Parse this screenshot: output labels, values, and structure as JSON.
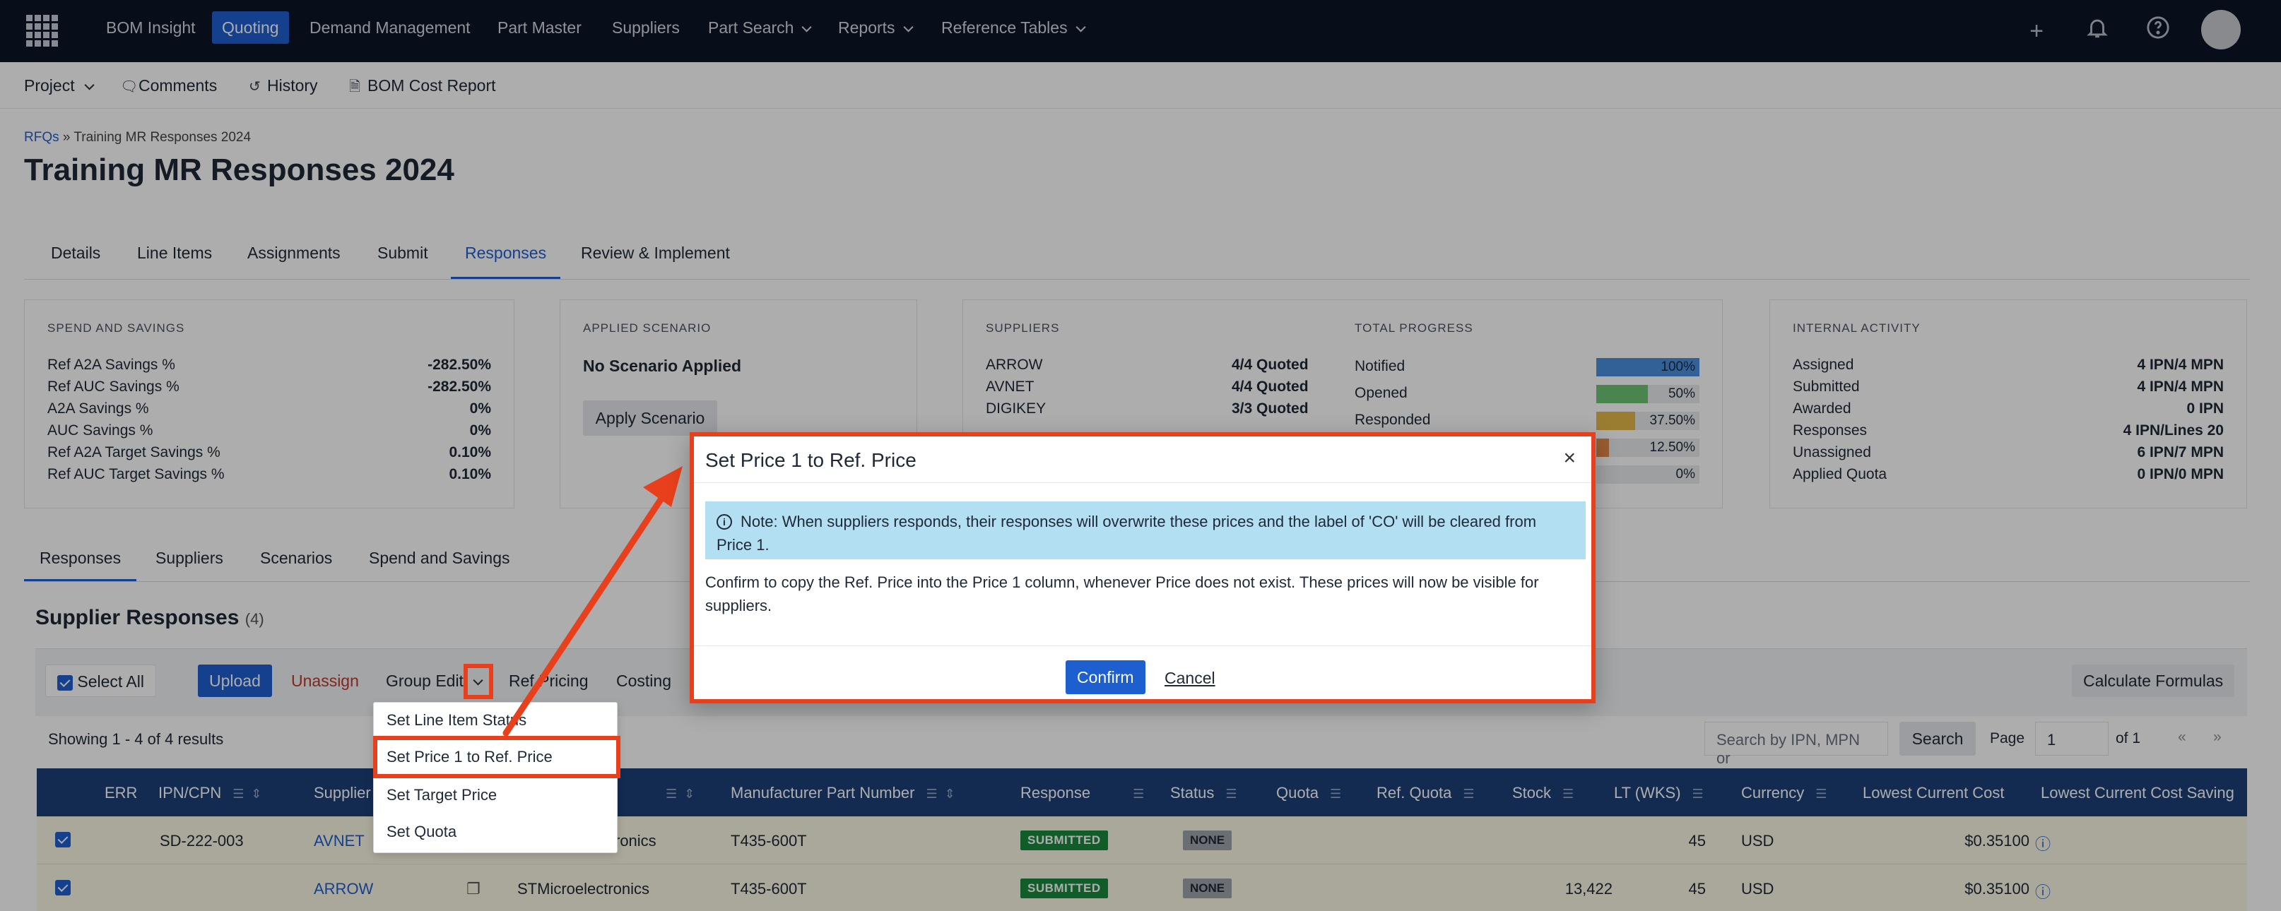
{
  "nav": {
    "items": [
      "BOM Insight",
      "Quoting",
      "Demand Management",
      "Part Master",
      "Suppliers",
      "Part Search",
      "Reports",
      "Reference Tables"
    ],
    "active": "Quoting"
  },
  "subbar": {
    "project": "Project",
    "comments": "Comments",
    "history": "History",
    "bom_cost_report": "BOM Cost Report"
  },
  "breadcrumb": {
    "root": "RFQs",
    "sep": "»",
    "current": "Training MR Responses 2024"
  },
  "page_title": "Training MR Responses 2024",
  "tabs": [
    "Details",
    "Line Items",
    "Assignments",
    "Submit",
    "Responses",
    "Review & Implement"
  ],
  "spend": {
    "title": "SPEND AND SAVINGS",
    "rows": [
      {
        "label": "Ref A2A Savings %",
        "value": "-282.50%"
      },
      {
        "label": "Ref AUC Savings %",
        "value": "-282.50%"
      },
      {
        "label": "A2A Savings %",
        "value": "0%"
      },
      {
        "label": "AUC Savings %",
        "value": "0%"
      },
      {
        "label": "Ref A2A Target Savings %",
        "value": "0.10%"
      },
      {
        "label": "Ref AUC Target Savings %",
        "value": "0.10%"
      }
    ]
  },
  "scenario": {
    "title": "APPLIED SCENARIO",
    "status": "No Scenario Applied",
    "apply_label": "Apply Scenario"
  },
  "suppliers_card": {
    "title": "SUPPLIERS",
    "rows": [
      {
        "name": "ARROW",
        "value": "4/4 Quoted"
      },
      {
        "name": "AVNET",
        "value": "4/4 Quoted"
      },
      {
        "name": "DIGIKEY",
        "value": "3/3 Quoted"
      }
    ]
  },
  "progress": {
    "title": "TOTAL PROGRESS",
    "rows": [
      {
        "label": "Notified",
        "pct": "100%",
        "value": 1.0,
        "color": "#4a8fe0"
      },
      {
        "label": "Opened",
        "pct": "50%",
        "value": 0.5,
        "color": "#6dc476"
      },
      {
        "label": "Responded",
        "pct": "37.50%",
        "value": 0.375,
        "color": "#e5b84a"
      },
      {
        "label": "",
        "pct": "12.50%",
        "value": 0.125,
        "color": "#e58a4a"
      },
      {
        "label": "",
        "pct": "0%",
        "value": 0.0,
        "color": "#e5a0b4"
      }
    ]
  },
  "internal": {
    "title": "INTERNAL ACTIVITY",
    "rows": [
      {
        "label": "Assigned",
        "value": "4 IPN/4 MPN"
      },
      {
        "label": "Submitted",
        "value": "4 IPN/4 MPN"
      },
      {
        "label": "Awarded",
        "value": "0 IPN"
      },
      {
        "label": "Responses",
        "value": "4 IPN/Lines 20"
      },
      {
        "label": "Unassigned",
        "value": "6 IPN/7 MPN"
      },
      {
        "label": "Applied Quota",
        "value": "0 IPN/0 MPN"
      }
    ]
  },
  "subtabs": [
    "Responses",
    "Suppliers",
    "Scenarios",
    "Spend and Savings"
  ],
  "section": {
    "title": "Supplier Responses",
    "count": "(4)"
  },
  "toolbar": {
    "select_all": "Select All",
    "upload": "Upload",
    "unassign": "Unassign",
    "group_edit": "Group Edit",
    "ref_pricing": "Ref Pricing",
    "costing": "Costing",
    "calculate": "Calculate Formulas"
  },
  "results": {
    "showing": "Showing 1 - 4 of 4 results",
    "search_placeholder": "Search by IPN, MPN or",
    "search_button": "Search",
    "page_label": "Page",
    "page_value": "1",
    "of_label": "of 1",
    "prev": "«",
    "next": "»"
  },
  "grid": {
    "headers": [
      "ERR",
      "IPN/CPN",
      "Supplier",
      "Manufacturer Part Number",
      "Response",
      "Status",
      "Quota",
      "Ref. Quota",
      "Stock",
      "LT (WKS)",
      "Currency",
      "Lowest Current Cost",
      "Lowest Current Cost Saving"
    ],
    "rows": [
      {
        "ipn": "SD-222-003",
        "supplier": "AVNET",
        "manufacturer": "ronics",
        "mpn": "T435-600T",
        "response": "SUBMITTED",
        "status": "NONE",
        "stock": "",
        "lt": "45",
        "currency": "USD",
        "cost": "$0.35100"
      },
      {
        "ipn": "",
        "supplier": "ARROW",
        "manufacturer": "STMicroelectronics",
        "mpn": "T435-600T",
        "response": "SUBMITTED",
        "status": "NONE",
        "stock": "13,422",
        "lt": "45",
        "currency": "USD",
        "cost": "$0.35100"
      }
    ]
  },
  "dropdown": {
    "items": [
      "Set Line Item Status",
      "Set Price 1 to Ref. Price",
      "Set Target Price",
      "Set Quota"
    ]
  },
  "modal": {
    "title": "Set Price 1 to Ref. Price",
    "close": "×",
    "note": "Note: When suppliers responds, their responses will overwrite these prices and the label of 'CO' will be cleared from Price 1.",
    "body": "Confirm to copy the Ref. Price into the Price 1 column, whenever Price does not exist. These prices will now be visible for suppliers.",
    "confirm": "Confirm",
    "cancel": "Cancel"
  },
  "colors": {
    "nav_bg": "#0b1526",
    "accent": "#1e5fd0",
    "annotation": "#e8401c",
    "grid_header": "#1c3f78",
    "submitted": "#1a8a3d"
  }
}
